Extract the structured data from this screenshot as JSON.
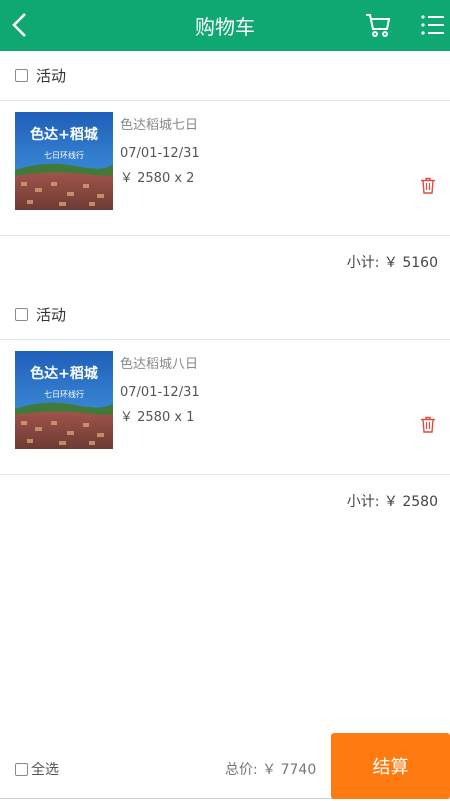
{
  "header": {
    "title": "购物车"
  },
  "groups": [
    {
      "label": "活动",
      "item": {
        "name": "色达稻城七日",
        "date": "07/01-12/31",
        "price": "￥ 2580 x 2",
        "image_title": "色达+稻城",
        "image_subtitle": "七日环线行"
      },
      "subtotal": "小计: ￥ 5160"
    },
    {
      "label": "活动",
      "item": {
        "name": "色达稻城八日",
        "date": "07/01-12/31",
        "price": "￥ 2580 x 1",
        "image_title": "色达+稻城",
        "image_subtitle": "七日环线行"
      },
      "subtotal": "小计: ￥ 2580"
    }
  ],
  "footer": {
    "select_all_label": "全选",
    "total": "总价: ￥ 7740",
    "checkout_label": "结算"
  },
  "colors": {
    "header": "#0fa870",
    "checkout": "#ff7a10",
    "trash": "#e64a3b"
  }
}
